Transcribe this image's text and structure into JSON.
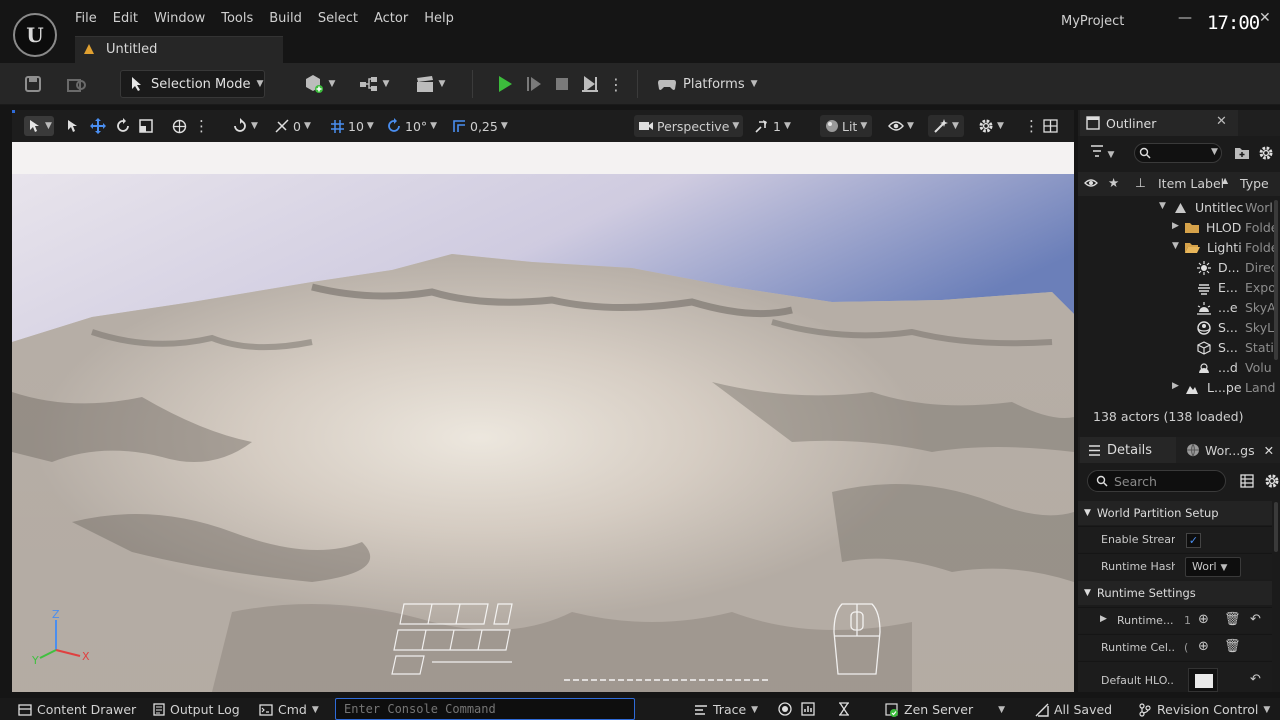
{
  "app": {
    "project_name": "MyProject",
    "clock": "17:00",
    "logo": "U"
  },
  "menu": [
    "File",
    "Edit",
    "Window",
    "Tools",
    "Build",
    "Select",
    "Actor",
    "Help"
  ],
  "document_tab": {
    "label": "Untitled",
    "icon": "level-icon"
  },
  "toolbar": {
    "selection_mode": "Selection Mode",
    "platforms": "Platforms"
  },
  "viewport_toolbar": {
    "rotation_snap_value": "0",
    "grid_snap": "10",
    "angle_snap": "10°",
    "scale_snap": "0,25",
    "view_mode": "Perspective",
    "camera_speed": "1",
    "lighting": "Lit"
  },
  "outliner": {
    "title": "Outliner",
    "columns": {
      "label": "Item Label",
      "type": "Type"
    },
    "rows": [
      {
        "label": "Untitlec",
        "type": "Worl",
        "icon": "level-icon"
      },
      {
        "label": "HLOD",
        "type": "Folde",
        "icon": "folder-icon"
      },
      {
        "label": "Lighti",
        "type": "Folde",
        "icon": "folder-open-icon"
      },
      {
        "label": "D...",
        "type": "Direc",
        "icon": "directional-light-icon"
      },
      {
        "label": "E...",
        "type": "Expo",
        "icon": "exponential-fog-icon"
      },
      {
        "label": "...e",
        "type": "SkyA",
        "icon": "sky-atmosphere-icon"
      },
      {
        "label": "S...",
        "type": "SkyL",
        "icon": "sky-light-icon"
      },
      {
        "label": "S...",
        "type": "Stati",
        "icon": "static-mesh-icon"
      },
      {
        "label": "...d",
        "type": "Volu",
        "icon": "volumetric-cloud-icon"
      },
      {
        "label": "L...pe",
        "type": "Land",
        "icon": "landscape-icon"
      }
    ],
    "actor_count": "138 actors (138 loaded)"
  },
  "details": {
    "tab_label": "Details",
    "world_settings_tab": "Wor...gs",
    "search_placeholder": "Search",
    "sections": [
      {
        "label": "World Partition Setup"
      },
      {
        "label": "Runtime Settings"
      }
    ],
    "props": {
      "enable_streaming": "Enable Stream",
      "runtime_hash": "Runtime Hash",
      "runtime_hash_value": "Worl",
      "runtime_grids": "Runtime...",
      "runtime_grids_count": "1",
      "runtime_cell": "Runtime Cel...",
      "runtime_cell_value": "(",
      "default_hlod": "Default HLO..."
    }
  },
  "statusbar": {
    "content_drawer": "Content Drawer",
    "output_log": "Output Log",
    "cmd": "Cmd",
    "console_placeholder": "Enter Console Command",
    "trace": "Trace",
    "zen_server": "Zen Server",
    "all_saved": "All Saved",
    "revision_control": "Revision Control"
  },
  "colors": {
    "accent_blue": "#2f6bd8",
    "play_green": "#3cbc3c",
    "sky_top": "#b9b8d6",
    "sky_right": "#6c7fb8"
  },
  "axes": {
    "z": "Z",
    "y": "Y",
    "x": "X"
  }
}
